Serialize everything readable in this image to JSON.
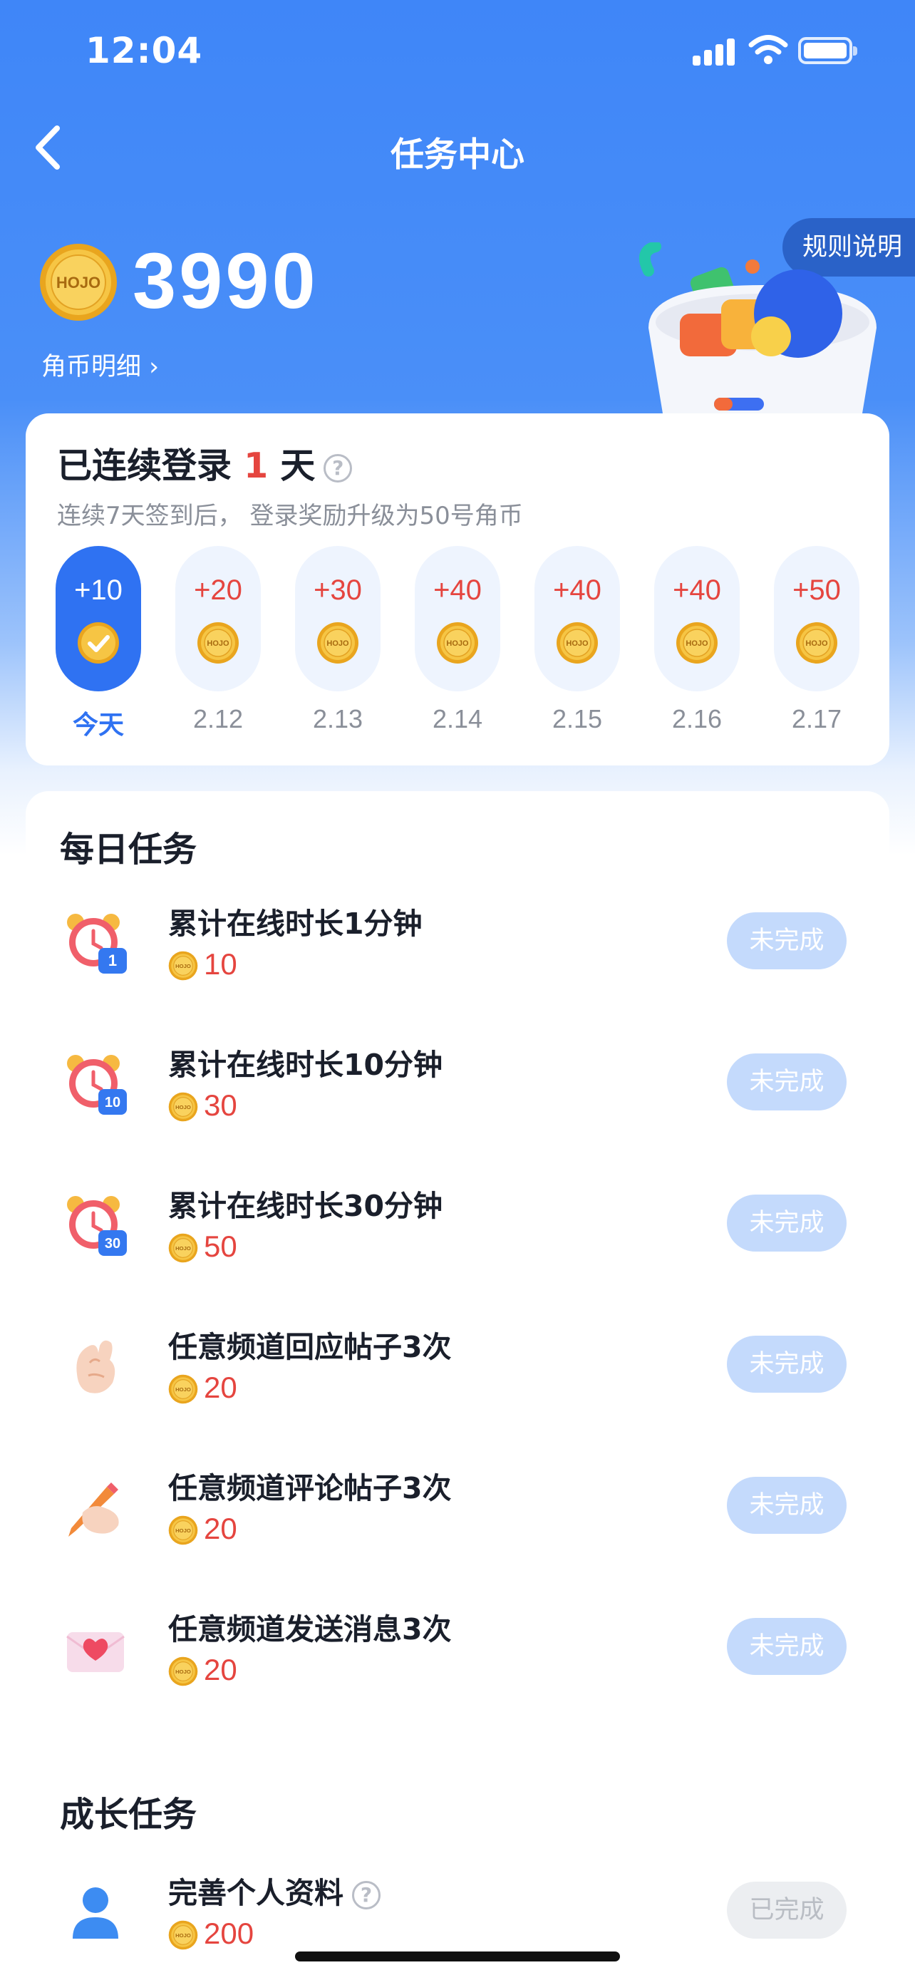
{
  "status_bar": {
    "time": "12:04"
  },
  "nav": {
    "title": "任务中心",
    "rules_label": "规则说明"
  },
  "balance": {
    "coin_text": "HOJO",
    "amount": "3990",
    "detail_link": "角币明细  ›"
  },
  "signin": {
    "title_prefix": "已连续登录 ",
    "days": "1",
    "title_suffix": " 天",
    "help": "?",
    "subtitle": "连续7天签到后， 登录奖励升级为50号角币",
    "items": [
      {
        "amount": "+10",
        "date": "今天",
        "today": true
      },
      {
        "amount": "+20",
        "date": "2.12"
      },
      {
        "amount": "+30",
        "date": "2.13"
      },
      {
        "amount": "+40",
        "date": "2.14"
      },
      {
        "amount": "+40",
        "date": "2.15"
      },
      {
        "amount": "+40",
        "date": "2.16"
      },
      {
        "amount": "+50",
        "date": "2.17"
      }
    ]
  },
  "daily": {
    "title": "每日任务",
    "tasks": [
      {
        "name": "累计在线时长1分钟",
        "reward": "10",
        "status": "未完成",
        "badge": "1"
      },
      {
        "name": "累计在线时长10分钟",
        "reward": "30",
        "status": "未完成",
        "badge": "10"
      },
      {
        "name": "累计在线时长30分钟",
        "reward": "50",
        "status": "未完成",
        "badge": "30"
      },
      {
        "name": "任意频道回应帖子3次",
        "reward": "20",
        "status": "未完成"
      },
      {
        "name": "任意频道评论帖子3次",
        "reward": "20",
        "status": "未完成"
      },
      {
        "name": "任意频道发送消息3次",
        "reward": "20",
        "status": "未完成"
      }
    ]
  },
  "growth": {
    "title": "成长任务",
    "tasks": [
      {
        "name": "完善个人资料",
        "reward": "200",
        "status": "已完成",
        "help": "?"
      }
    ]
  },
  "colors": {
    "primary": "#2f72f2",
    "reward_red": "#e5453f",
    "pending_btn": "#c4dafc",
    "done_btn": "#eceef1"
  }
}
